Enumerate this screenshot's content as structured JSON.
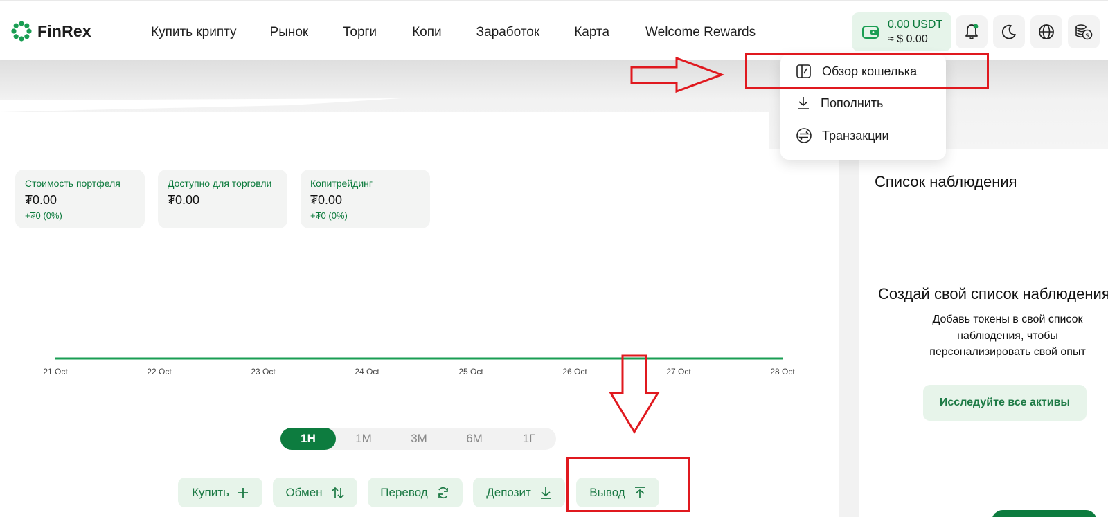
{
  "header": {
    "brand": "FinRex",
    "nav": [
      "Купить крипту",
      "Рынок",
      "Торги",
      "Копи",
      "Заработок",
      "Карта",
      "Welcome Rewards"
    ],
    "wallet": {
      "usdt": "0.00 USDT",
      "usd": "≈ $ 0.00"
    },
    "icons": [
      "wallet-icon",
      "bell-icon",
      "moon-icon",
      "globe-icon",
      "currency-icon"
    ]
  },
  "wallet_menu": {
    "items": [
      "Обзор кошелька",
      "Пополнить",
      "Транзакции"
    ]
  },
  "cards": [
    {
      "title": "Стоимость портфеля",
      "value": "₮0.00",
      "change": "+₮0 (0%)"
    },
    {
      "title": "Доступно для торговли",
      "value": "₮0.00",
      "change": ""
    },
    {
      "title": "Копитрейдинг",
      "value": "₮0.00",
      "change": "+₮0 (0%)"
    }
  ],
  "chart_data": {
    "type": "line",
    "x": [
      "21 Oct",
      "22 Oct",
      "23 Oct",
      "24 Oct",
      "25 Oct",
      "26 Oct",
      "27 Oct",
      "28 Oct"
    ],
    "series": [
      {
        "values": [
          0,
          0,
          0,
          0,
          0,
          0,
          0,
          0
        ]
      }
    ],
    "color": "#1a9e53"
  },
  "periods": {
    "options": [
      "1Н",
      "1М",
      "3М",
      "6М",
      "1Г"
    ],
    "active": "1Н"
  },
  "actions": [
    "Купить",
    "Обмен",
    "Перевод",
    "Депозит",
    "Вывод"
  ],
  "watchlist": {
    "title": "Список наблюдения",
    "headline": "Создай свой список наблюдения",
    "description": "Добавь токены в свой список наблюдения, чтобы персонализировать свой опыт",
    "button": "Исследуйте все активы"
  },
  "colors": {
    "brand": "#0d7c3f",
    "accent_bg": "#e7f4ea",
    "annotation": "#e0191f"
  }
}
